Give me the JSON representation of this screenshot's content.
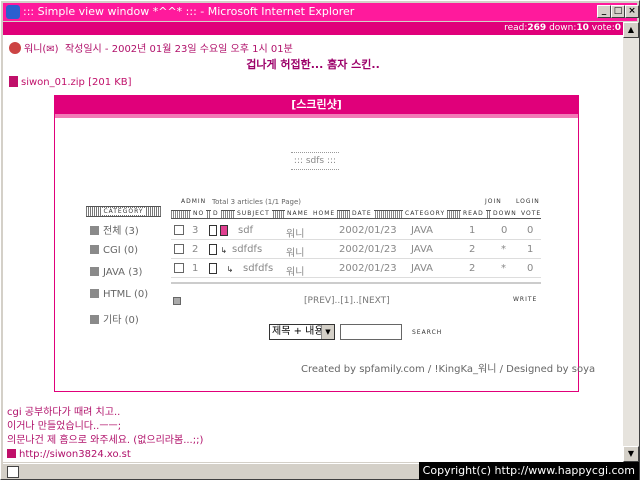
{
  "window": {
    "title": "::: Simple view window *^^* ::: - Microsoft Internet Explorer",
    "minimize": "_",
    "maximize": "□",
    "close": "×"
  },
  "stats": {
    "read_label": "read:",
    "read_value": "269",
    "down_label": "down:",
    "down_value": "10",
    "vote_label": "vote:",
    "vote_value": "0"
  },
  "post": {
    "author": "워니",
    "meta": "작성일시 - 2002년 01월 23일 수요일 오후 1시 01분",
    "subject": "겁나게 허접한... 홈자 스킨..",
    "file": "siwon_01.zip [201 KB]"
  },
  "board": {
    "header": "[스크린샷]",
    "preview_title": "::: sdfs :::",
    "category_header": "CATEGORY",
    "categories": [
      {
        "label": "전체 (3)"
      },
      {
        "label": "CGI (0)"
      },
      {
        "label": "JAVA (3)"
      },
      {
        "label": "HTML (0)"
      },
      {
        "label": "기타 (0)"
      }
    ],
    "admin": "ADMIN",
    "total": "Total 3 articles (1/1 Page)",
    "join": "JOIN",
    "login": "LOGIN",
    "columns": [
      "NO",
      "D",
      "SUBJECT",
      "NAME",
      "HOME",
      "DATE",
      "CATEGORY",
      "READ",
      "DOWN",
      "VOTE"
    ],
    "rows": [
      {
        "no": "3",
        "subject": "sdf",
        "name": "워니",
        "date": "2002/01/23",
        "category": "JAVA",
        "read": "1",
        "down": "0",
        "vote": "0"
      },
      {
        "no": "2",
        "subject": "sdfdfs",
        "name": "워니",
        "date": "2002/01/23",
        "category": "JAVA",
        "read": "2",
        "down": "*",
        "vote": "1"
      },
      {
        "no": "1",
        "subject": "sdfdfs",
        "name": "워니",
        "date": "2002/01/23",
        "category": "JAVA",
        "read": "2",
        "down": "*",
        "vote": "0"
      }
    ],
    "pager": "[PREV]..[1]..[NEXT]",
    "write": "WRITE",
    "search_select": "제목 + 내용",
    "search_value": "",
    "search_button": "SEARCH",
    "credit": "Created by spfamily.com / !KingKa_워니 / Designed by soya"
  },
  "body_lines": [
    "cgi 공부하다가 때려 치고..",
    "이거나 만들었습니다..ㅡㅡ;",
    "의문나건 제 홈으로 와주세요. (없으리라봄...;;)"
  ],
  "homepage": "http://siwon3824.xo.st",
  "copyright": "Copyright(c) http://www.happycgi.com"
}
